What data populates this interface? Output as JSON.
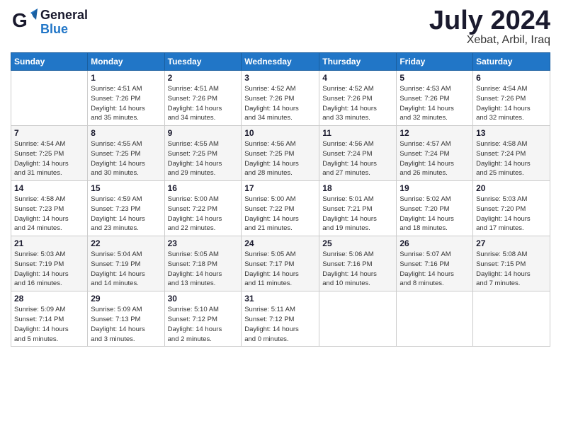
{
  "header": {
    "logo_general": "General",
    "logo_blue": "Blue",
    "main_title": "July 2024",
    "subtitle": "Xebat, Arbil, Iraq"
  },
  "calendar": {
    "days_of_week": [
      "Sunday",
      "Monday",
      "Tuesday",
      "Wednesday",
      "Thursday",
      "Friday",
      "Saturday"
    ],
    "weeks": [
      [
        {
          "day": "",
          "info": ""
        },
        {
          "day": "1",
          "info": "Sunrise: 4:51 AM\nSunset: 7:26 PM\nDaylight: 14 hours\nand 35 minutes."
        },
        {
          "day": "2",
          "info": "Sunrise: 4:51 AM\nSunset: 7:26 PM\nDaylight: 14 hours\nand 34 minutes."
        },
        {
          "day": "3",
          "info": "Sunrise: 4:52 AM\nSunset: 7:26 PM\nDaylight: 14 hours\nand 34 minutes."
        },
        {
          "day": "4",
          "info": "Sunrise: 4:52 AM\nSunset: 7:26 PM\nDaylight: 14 hours\nand 33 minutes."
        },
        {
          "day": "5",
          "info": "Sunrise: 4:53 AM\nSunset: 7:26 PM\nDaylight: 14 hours\nand 32 minutes."
        },
        {
          "day": "6",
          "info": "Sunrise: 4:54 AM\nSunset: 7:26 PM\nDaylight: 14 hours\nand 32 minutes."
        }
      ],
      [
        {
          "day": "7",
          "info": "Sunrise: 4:54 AM\nSunset: 7:25 PM\nDaylight: 14 hours\nand 31 minutes."
        },
        {
          "day": "8",
          "info": "Sunrise: 4:55 AM\nSunset: 7:25 PM\nDaylight: 14 hours\nand 30 minutes."
        },
        {
          "day": "9",
          "info": "Sunrise: 4:55 AM\nSunset: 7:25 PM\nDaylight: 14 hours\nand 29 minutes."
        },
        {
          "day": "10",
          "info": "Sunrise: 4:56 AM\nSunset: 7:25 PM\nDaylight: 14 hours\nand 28 minutes."
        },
        {
          "day": "11",
          "info": "Sunrise: 4:56 AM\nSunset: 7:24 PM\nDaylight: 14 hours\nand 27 minutes."
        },
        {
          "day": "12",
          "info": "Sunrise: 4:57 AM\nSunset: 7:24 PM\nDaylight: 14 hours\nand 26 minutes."
        },
        {
          "day": "13",
          "info": "Sunrise: 4:58 AM\nSunset: 7:24 PM\nDaylight: 14 hours\nand 25 minutes."
        }
      ],
      [
        {
          "day": "14",
          "info": "Sunrise: 4:58 AM\nSunset: 7:23 PM\nDaylight: 14 hours\nand 24 minutes."
        },
        {
          "day": "15",
          "info": "Sunrise: 4:59 AM\nSunset: 7:23 PM\nDaylight: 14 hours\nand 23 minutes."
        },
        {
          "day": "16",
          "info": "Sunrise: 5:00 AM\nSunset: 7:22 PM\nDaylight: 14 hours\nand 22 minutes."
        },
        {
          "day": "17",
          "info": "Sunrise: 5:00 AM\nSunset: 7:22 PM\nDaylight: 14 hours\nand 21 minutes."
        },
        {
          "day": "18",
          "info": "Sunrise: 5:01 AM\nSunset: 7:21 PM\nDaylight: 14 hours\nand 19 minutes."
        },
        {
          "day": "19",
          "info": "Sunrise: 5:02 AM\nSunset: 7:20 PM\nDaylight: 14 hours\nand 18 minutes."
        },
        {
          "day": "20",
          "info": "Sunrise: 5:03 AM\nSunset: 7:20 PM\nDaylight: 14 hours\nand 17 minutes."
        }
      ],
      [
        {
          "day": "21",
          "info": "Sunrise: 5:03 AM\nSunset: 7:19 PM\nDaylight: 14 hours\nand 16 minutes."
        },
        {
          "day": "22",
          "info": "Sunrise: 5:04 AM\nSunset: 7:19 PM\nDaylight: 14 hours\nand 14 minutes."
        },
        {
          "day": "23",
          "info": "Sunrise: 5:05 AM\nSunset: 7:18 PM\nDaylight: 14 hours\nand 13 minutes."
        },
        {
          "day": "24",
          "info": "Sunrise: 5:05 AM\nSunset: 7:17 PM\nDaylight: 14 hours\nand 11 minutes."
        },
        {
          "day": "25",
          "info": "Sunrise: 5:06 AM\nSunset: 7:16 PM\nDaylight: 14 hours\nand 10 minutes."
        },
        {
          "day": "26",
          "info": "Sunrise: 5:07 AM\nSunset: 7:16 PM\nDaylight: 14 hours\nand 8 minutes."
        },
        {
          "day": "27",
          "info": "Sunrise: 5:08 AM\nSunset: 7:15 PM\nDaylight: 14 hours\nand 7 minutes."
        }
      ],
      [
        {
          "day": "28",
          "info": "Sunrise: 5:09 AM\nSunset: 7:14 PM\nDaylight: 14 hours\nand 5 minutes."
        },
        {
          "day": "29",
          "info": "Sunrise: 5:09 AM\nSunset: 7:13 PM\nDaylight: 14 hours\nand 3 minutes."
        },
        {
          "day": "30",
          "info": "Sunrise: 5:10 AM\nSunset: 7:12 PM\nDaylight: 14 hours\nand 2 minutes."
        },
        {
          "day": "31",
          "info": "Sunrise: 5:11 AM\nSunset: 7:12 PM\nDaylight: 14 hours\nand 0 minutes."
        },
        {
          "day": "",
          "info": ""
        },
        {
          "day": "",
          "info": ""
        },
        {
          "day": "",
          "info": ""
        }
      ]
    ]
  }
}
